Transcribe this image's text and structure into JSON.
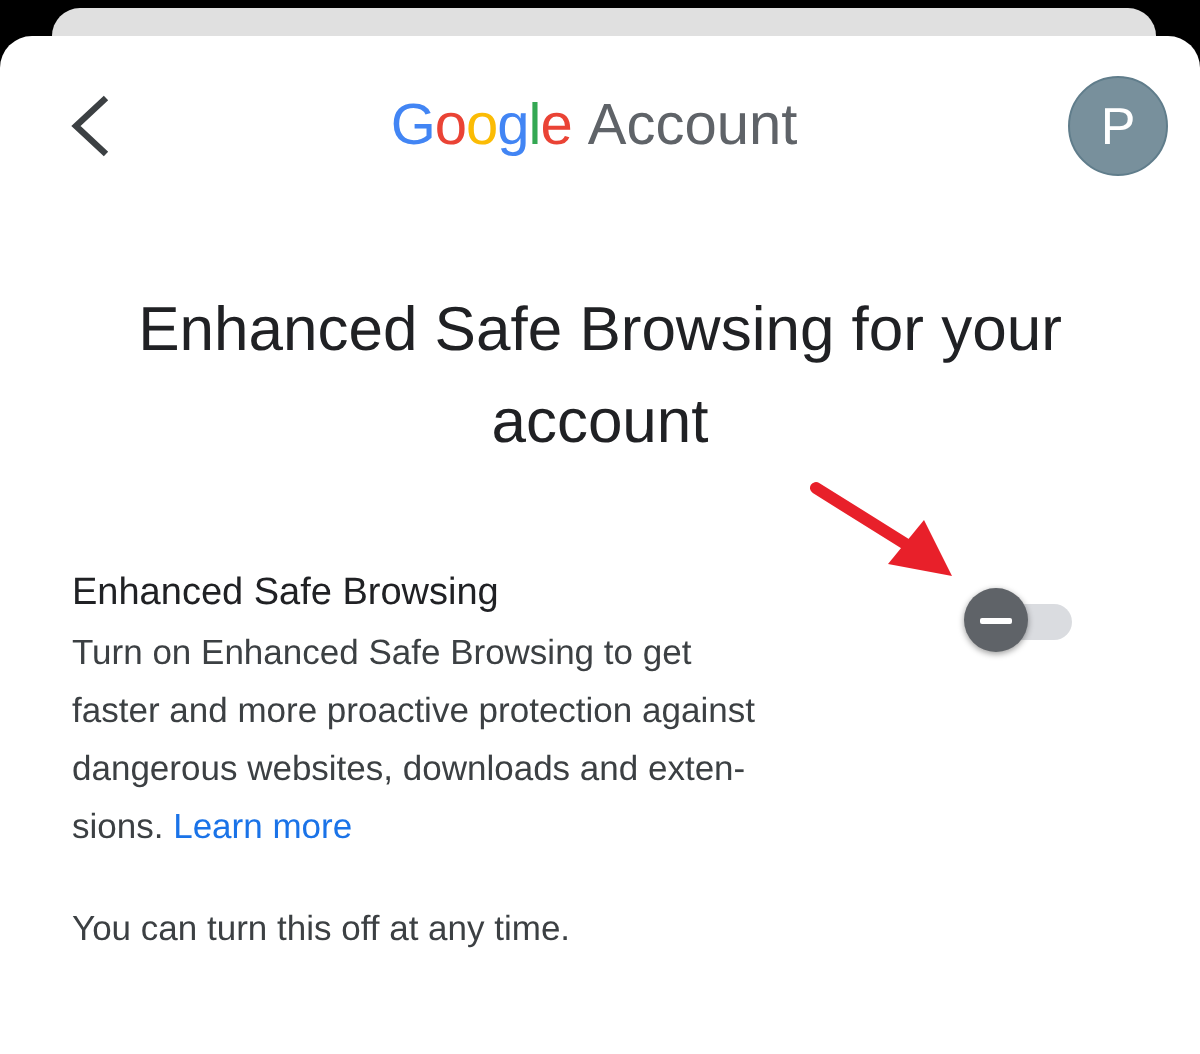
{
  "header": {
    "logo": "Google",
    "product": "Account",
    "avatar": "P"
  },
  "title": "Enhanced Safe Browsing for your account",
  "setting": {
    "label": "Enhanced Safe Browsing",
    "on": false,
    "description_lines": [
      "Turn on Enhanced Safe Browsing to get",
      "faster and more proactive protection against",
      "dangerous websites, downloads and exten-",
      "sions."
    ],
    "link": "Learn more"
  },
  "footnote": "You can turn this off at any time."
}
